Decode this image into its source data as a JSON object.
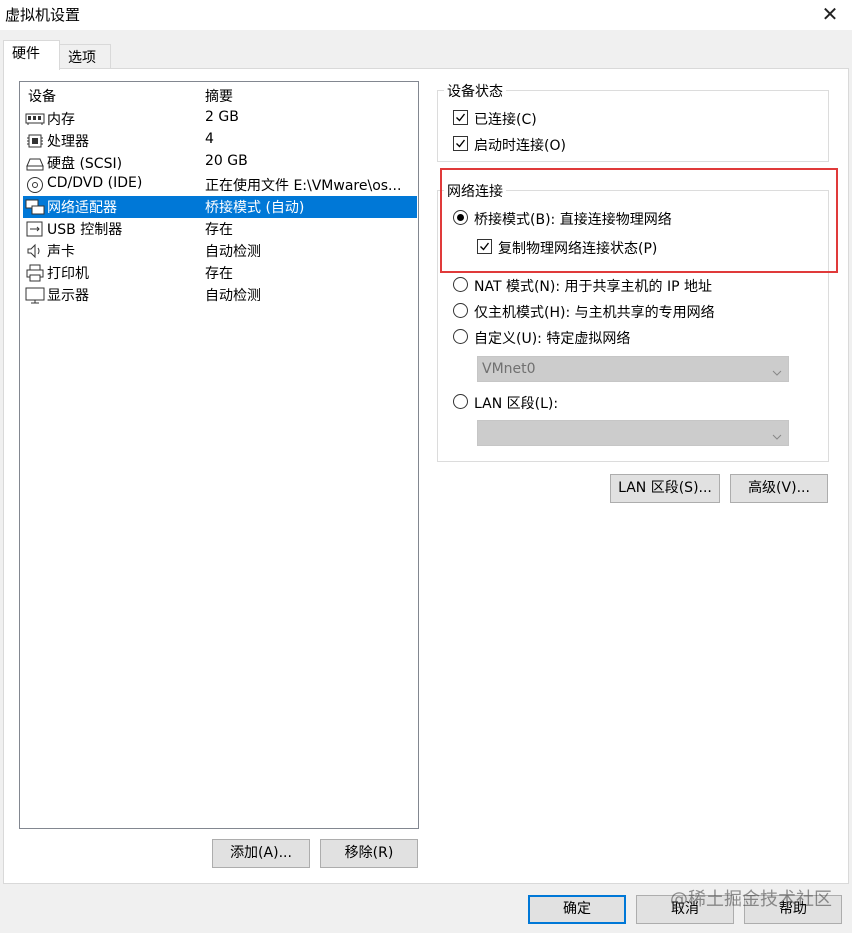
{
  "window": {
    "title": "虚拟机设置",
    "close_glyph": "✕"
  },
  "tabs": [
    {
      "label": "硬件"
    },
    {
      "label": "选项"
    }
  ],
  "device_table": {
    "headers": {
      "device": "设备",
      "summary": "摘要"
    },
    "rows": [
      {
        "icon": "memory-icon",
        "name": "内存",
        "summary": "2 GB"
      },
      {
        "icon": "processor-icon",
        "name": "处理器",
        "summary": "4"
      },
      {
        "icon": "hard-disk-icon",
        "name": "硬盘 (SCSI)",
        "summary": "20 GB"
      },
      {
        "icon": "cd-dvd-icon",
        "name": "CD/DVD (IDE)",
        "summary": "正在使用文件 E:\\VMware\\os..."
      },
      {
        "icon": "network-adapter-icon",
        "name": "网络适配器",
        "summary": "桥接模式 (自动)",
        "selected": true
      },
      {
        "icon": "usb-icon",
        "name": "USB 控制器",
        "summary": "存在"
      },
      {
        "icon": "sound-card-icon",
        "name": "声卡",
        "summary": "自动检测"
      },
      {
        "icon": "printer-icon",
        "name": "打印机",
        "summary": "存在"
      },
      {
        "icon": "display-icon",
        "name": "显示器",
        "summary": "自动检测"
      }
    ]
  },
  "list_buttons": {
    "add": "添加(A)...",
    "remove": "移除(R)"
  },
  "device_status": {
    "title": "设备状态",
    "connected": {
      "label": "已连接(C)",
      "checked": true
    },
    "connect_at_power_on": {
      "label": "启动时连接(O)",
      "checked": true
    }
  },
  "network_connection": {
    "title": "网络连接",
    "bridged": {
      "label": "桥接模式(B): 直接连接物理网络",
      "selected": true
    },
    "replicate": {
      "label": "复制物理网络连接状态(P)",
      "checked": true
    },
    "nat": {
      "label": "NAT 模式(N): 用于共享主机的 IP 地址",
      "selected": false
    },
    "host_only": {
      "label": "仅主机模式(H): 与主机共享的专用网络",
      "selected": false
    },
    "custom": {
      "label": "自定义(U): 特定虚拟网络",
      "selected": false,
      "value": "VMnet0"
    },
    "lan_segment": {
      "label": "LAN 区段(L):",
      "selected": false,
      "value": ""
    }
  },
  "network_buttons": {
    "lan_segments": "LAN 区段(S)...",
    "advanced": "高级(V)..."
  },
  "dialog_buttons": {
    "ok": "确定",
    "cancel": "取消",
    "help": "帮助"
  },
  "watermark": "@稀土掘金技术社区",
  "colors": {
    "selection": "#0078d7",
    "highlight_border": "#e03a3a"
  }
}
